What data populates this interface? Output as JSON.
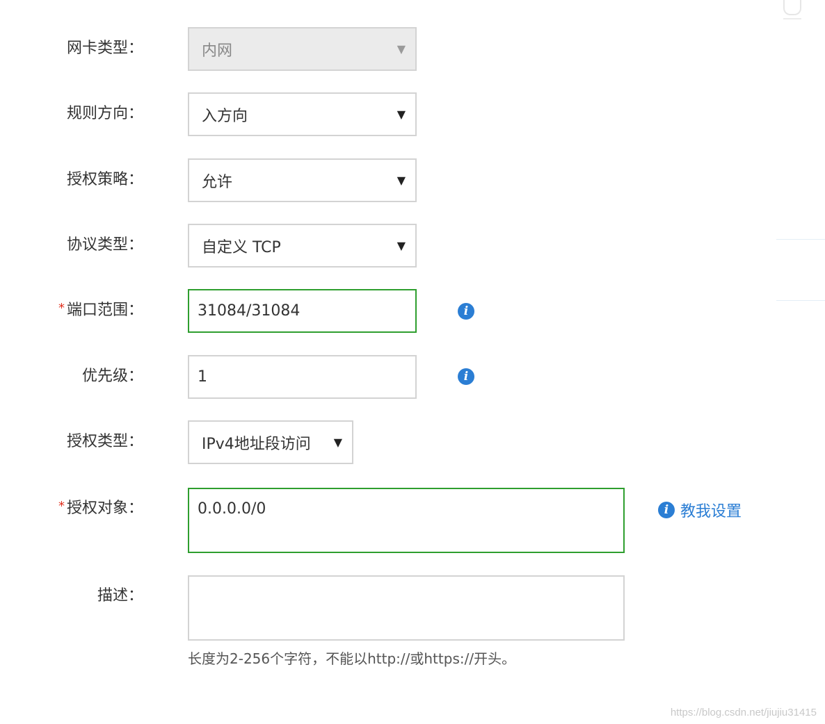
{
  "form": {
    "nic_type": {
      "label": "网卡类型：",
      "value": "内网",
      "disabled": true
    },
    "rule_direction": {
      "label": "规则方向：",
      "value": "入方向"
    },
    "auth_policy": {
      "label": "授权策略：",
      "value": "允许"
    },
    "protocol_type": {
      "label": "协议类型：",
      "value": "自定义 TCP"
    },
    "port_range": {
      "required_mark": "*",
      "label": "端口范围：",
      "value": "31084/31084"
    },
    "priority": {
      "label": "优先级：",
      "value": "1"
    },
    "auth_type": {
      "label": "授权类型：",
      "value": "IPv4地址段访问"
    },
    "auth_object": {
      "required_mark": "*",
      "label": "授权对象：",
      "value": "0.0.0.0/0",
      "help_link": "教我设置"
    },
    "description": {
      "label": "描述：",
      "value": "",
      "hint": "长度为2-256个字符，不能以http://或https://开头。"
    }
  },
  "icons": {
    "dropdown": "▼",
    "info": "i"
  },
  "colors": {
    "valid_border": "#2e9e2e",
    "info_blue": "#2b7ed4",
    "required_star": "#e0301e",
    "disabled_bg": "#ebebeb"
  },
  "watermark": "https://blog.csdn.net/jiujiu31415"
}
